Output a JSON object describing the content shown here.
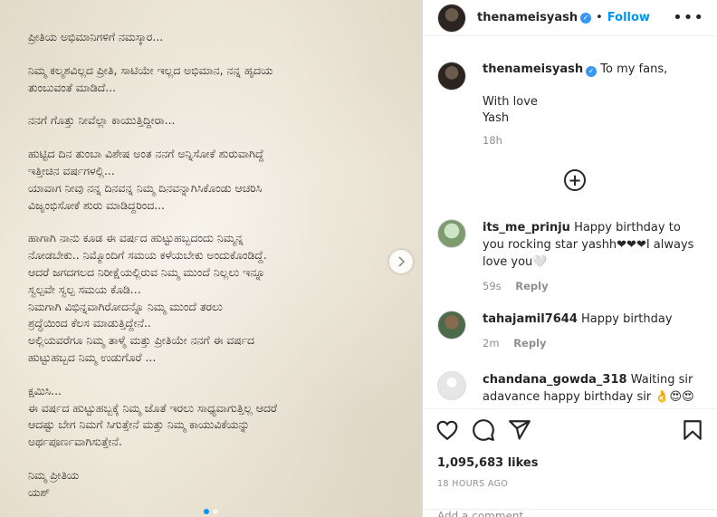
{
  "post": {
    "letter": [
      "ಪ್ರೀತಿಯ ಅಭಿಮಾನಿಗಳಿಗೆ ನಮಸ್ಕಾರ...",
      "ನಿಮ್ಮ ಕಲ್ಮಶವಿಲ್ಲದ ಪ್ರೀತಿ, ಸಾಟಿಯೇ ಇಲ್ಲದ ಅಭಿಮಾನ, ನನ್ನ ಹೃದಯ\nತುಂಬುವಂತೆ ಮಾಡಿದೆ...",
      "ನನಗೆ ಗೊತ್ತು ನೀವೆಲ್ಲಾ ಕಾಯುತ್ತಿದ್ದೀರಾ...",
      "ಹುಟ್ಟಿದ ದಿನ ತುಂಬಾ ವಿಶೇಷ ಅಂತ ನನಗೆ ಅನ್ನಿಸೋಕೆ ಶುರುವಾಗಿದ್ದೆ\nಇತ್ತೀಚಿನ ವರ್ಷಗಳಲ್ಲಿ...\nಯಾವಾಗ ನೀವು ನನ್ನ ದಿನವನ್ನ ನಿಮ್ಮ ದಿನವನ್ನಾಗಿಸಿಕೊಂಡು ಆಚರಿಸಿ\nವಿಜೃಂಭಿಸೋಕೆ ಶುರು ಮಾಡಿದ್ದರಿಂದ...",
      "ಹಾಗಾಗಿ ನಾನು ಕೂಡ ಈ ವರ್ಷದ ಹುಟ್ಟುಹಬ್ಬದಂದು ನಿಮ್ಮನ್ನ\nನೋಡಬೇಕು.. ನಿಮ್ಮೊಂದಿಗೆ ಸಮಯ ಕಳೆಯಬೇಕು ಅಂದುಕೊಂಡಿದ್ದೆ.\nಆದರೆ ಜಗದಗಲದ ನಿರೀಕ್ಷೆಯಲ್ಲಿರುವ ನಿಮ್ಮ ಮುಂದೆ ನಿಲ್ಲಲು ಇನ್ನೂ\nಸ್ವಲ್ಪವೇ ಸ್ವಲ್ಪ ಸಮಯ ಕೊಡಿ...\nನಿಮಗಾಗಿ ವಿಭಿನ್ನವಾಗಿರೋದನ್ನೊ ನಿಮ್ಮ ಮುಂದೆ ತರಲು\nಶ್ರದ್ಧೆಯಿಂದ ಕೆಲಸ ಮಾಡುತ್ತಿದ್ದೇನೆ..\nಅಲ್ಲಿಯವರೆಗೂ ನಿಮ್ಮ ತಾಳ್ಮೆ ಮತ್ತು ಪ್ರೀತಿಯೇ ನನಗೆ ಈ ವರ್ಷದ\nಹುಟ್ಟುಹಬ್ಬದ ನಿಮ್ಮ ಉಡುಗೊರೆ ...",
      "ಕ್ಷಮಿಸಿ...\nಈ ವರ್ಷದ ಹುಟ್ಟುಹಬ್ಬಕ್ಕೆ ನಿಮ್ಮ ಜೊತೆ ಇರಲು ಸಾಧ್ಯವಾಗುತ್ತಿಲ್ಲ ಆದರೆ\nಆದಷ್ಟು ಬೇಗ ನಿಮಗೆ ಸಿಗುತ್ತೇನೆ ಮತ್ತು ನಿಮ್ಮ ಕಾಯುವಿಕೆಯನ್ನು\nಅರ್ಥಪೂರ್ಣವಾಗಿಸುತ್ತೇನೆ.",
      "ನಿಮ್ಮ ಪ್ರೀತಿಯ\nಯಶ್"
    ]
  },
  "header": {
    "username": "thenameisyash",
    "separator": "•",
    "follow_label": "Follow",
    "more_label": "•••"
  },
  "caption": {
    "username": "thenameisyash",
    "line1": "To my fans,",
    "line2": "With love",
    "line3": "Yash",
    "time": "18h"
  },
  "comments": [
    {
      "username": "its_me_prinju",
      "text": "Happy birthday to you rocking star yashh❤❤❤I always love you🤍",
      "time": "59s",
      "reply": "Reply"
    },
    {
      "username": "tahajamil7644",
      "text": "Happy birthday",
      "time": "2m",
      "reply": "Reply"
    },
    {
      "username": "chandana_gowda_318",
      "text": "Waiting sir adavance happy birthday sir 👌😍😍",
      "time": "",
      "reply": ""
    }
  ],
  "actions": {
    "likes": "1,095,683 likes",
    "posted": "18 HOURS AGO",
    "add_comment_placeholder": "Add a comment..."
  },
  "colors": {
    "accent": "#0095f6",
    "verified": "#3897f0",
    "muted": "#8e8e8e"
  },
  "icons": [
    "verified-badge-icon",
    "more-options-icon",
    "next-arrow-icon",
    "load-more-comments-icon",
    "heart-icon",
    "comment-icon",
    "share-icon",
    "bookmark-icon"
  ]
}
